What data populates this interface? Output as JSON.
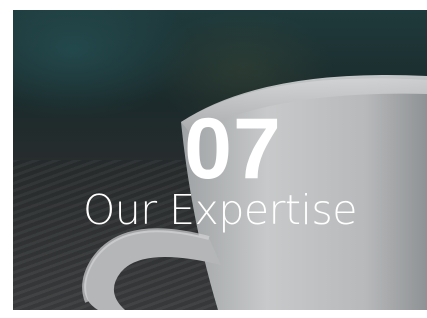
{
  "card": {
    "number": "07",
    "title": "Our Expertise"
  },
  "colors": {
    "overlay_text": "#ffffff",
    "backdrop_dark": "#1b2a2b",
    "cup": "#c9cacb"
  }
}
